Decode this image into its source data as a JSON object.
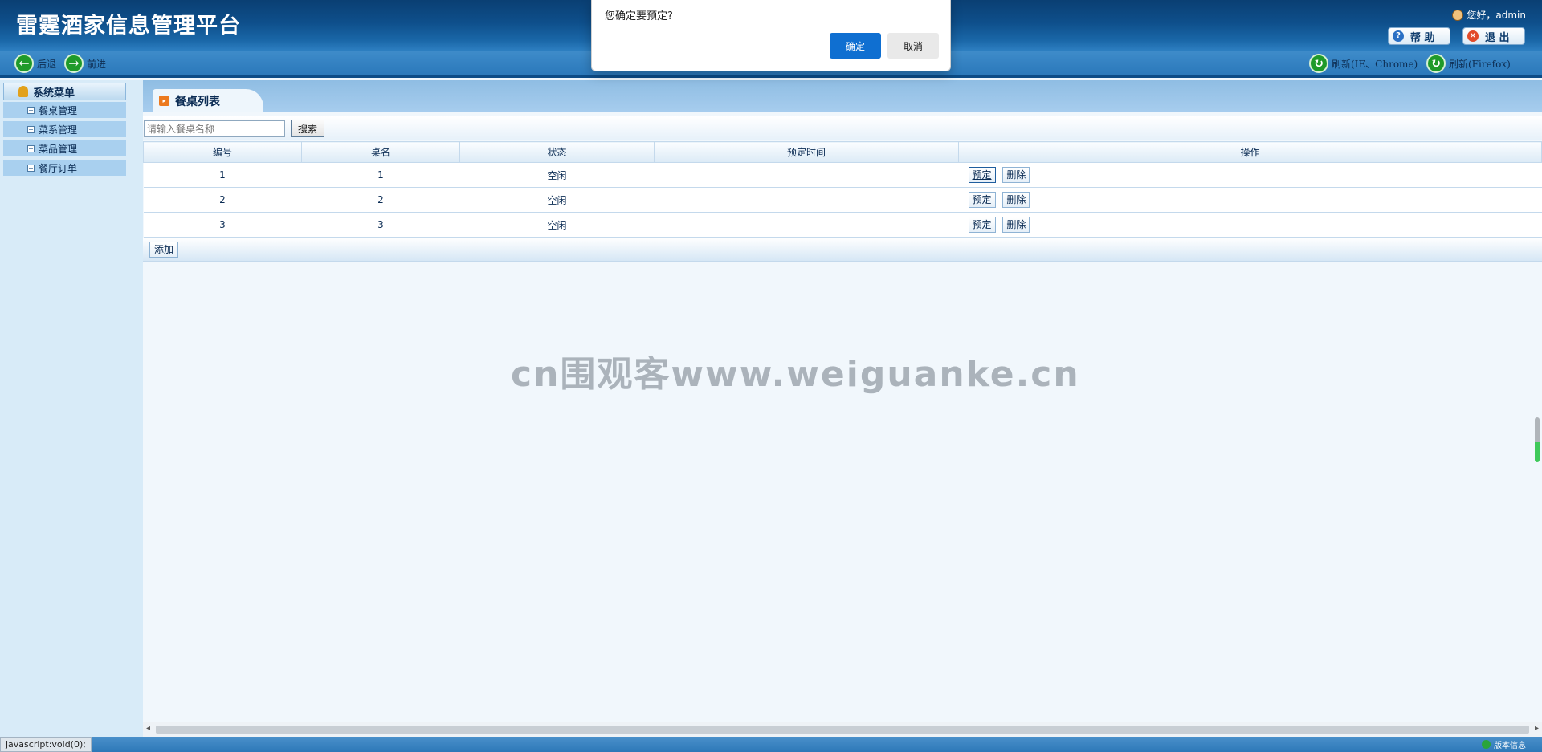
{
  "header": {
    "title": "雷霆酒家信息管理平台",
    "greeting": "您好，admin",
    "help_label": "帮 助",
    "logout_label": "退 出"
  },
  "nav": {
    "back": "后退",
    "forward": "前进",
    "refresh_ie": "刷新(IE、Chrome)",
    "refresh_ff": "刷新(Firefox)"
  },
  "sidebar": {
    "header": "系统菜单",
    "items": [
      {
        "label": "餐桌管理"
      },
      {
        "label": "菜系管理"
      },
      {
        "label": "菜品管理"
      },
      {
        "label": "餐厅订单"
      }
    ]
  },
  "tab": {
    "title": "餐桌列表"
  },
  "search": {
    "placeholder": "请输入餐桌名称",
    "button": "搜索"
  },
  "table": {
    "columns": [
      "编号",
      "桌名",
      "状态",
      "预定时间",
      "操作"
    ],
    "rows": [
      {
        "id": "1",
        "name": "1",
        "status": "空闲",
        "time": "",
        "reserve": "预定",
        "delete": "删除"
      },
      {
        "id": "2",
        "name": "2",
        "status": "空闲",
        "time": "",
        "reserve": "预定",
        "delete": "删除"
      },
      {
        "id": "3",
        "name": "3",
        "status": "空闲",
        "time": "",
        "reserve": "预定",
        "delete": "删除"
      }
    ]
  },
  "add_button": "添加",
  "watermark": "cn围观客www.weiguanke.cn",
  "statusbar": {
    "url": "javascript:void(0);",
    "version": "版本信息"
  },
  "dialog": {
    "message": "您确定要预定?",
    "ok": "确定",
    "cancel": "取消"
  },
  "colors": {
    "header": "#0e4f8b",
    "nav": "#2a78ba",
    "ok_button": "#0f6fd1",
    "sidebar": "#d8ebf8"
  },
  "icons": {
    "user": "user-icon",
    "help": "help-icon",
    "logout": "logout-icon",
    "back": "arrow-left-icon",
    "forward": "arrow-right-icon",
    "refresh": "refresh-icon",
    "menu": "menu-icon",
    "expand": "plus-icon",
    "tab": "list-icon",
    "version": "info-icon"
  }
}
